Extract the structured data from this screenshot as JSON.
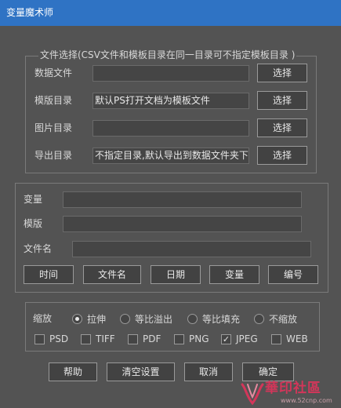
{
  "window": {
    "title": "变量魔术师"
  },
  "file_group": {
    "legend": "文件选择(CSV文件和模板目录在同一目录可不指定模板目录 )",
    "rows": [
      {
        "label": "数据文件",
        "value": "",
        "button": "选择"
      },
      {
        "label": "模版目录",
        "value": "默认PS打开文档为模板文件",
        "button": "选择"
      },
      {
        "label": "图片目录",
        "value": "",
        "button": "选择"
      },
      {
        "label": "导出目录",
        "value": "不指定目录,默认导出到数据文件夹下",
        "button": "选择"
      }
    ]
  },
  "naming_group": {
    "variable_label": "变量",
    "variable_value": "",
    "template_label": "模版",
    "template_value": "",
    "filename_label": "文件名",
    "filename_value": "",
    "buttons": [
      "时间",
      "文件名",
      "日期",
      "变量",
      "编号"
    ]
  },
  "output_group": {
    "scale_label": "缩放",
    "scale_options": [
      {
        "label": "拉伸",
        "selected": true
      },
      {
        "label": "等比溢出",
        "selected": false
      },
      {
        "label": "等比填充",
        "selected": false
      },
      {
        "label": "不缩放",
        "selected": false
      }
    ],
    "formats": [
      {
        "label": "PSD",
        "checked": false
      },
      {
        "label": "TIFF",
        "checked": false
      },
      {
        "label": "PDF",
        "checked": false
      },
      {
        "label": "PNG",
        "checked": false
      },
      {
        "label": "JPEG",
        "checked": true
      },
      {
        "label": "WEB",
        "checked": false
      }
    ]
  },
  "actions": {
    "help": "帮助",
    "clear": "清空设置",
    "cancel": "取消",
    "ok": "确定"
  },
  "watermark": {
    "title": "華印社區",
    "url": "www.52cnp.com"
  },
  "colors": {
    "titlebar": "#2f73c4",
    "background": "#535353",
    "watermark": "#d3365a"
  }
}
